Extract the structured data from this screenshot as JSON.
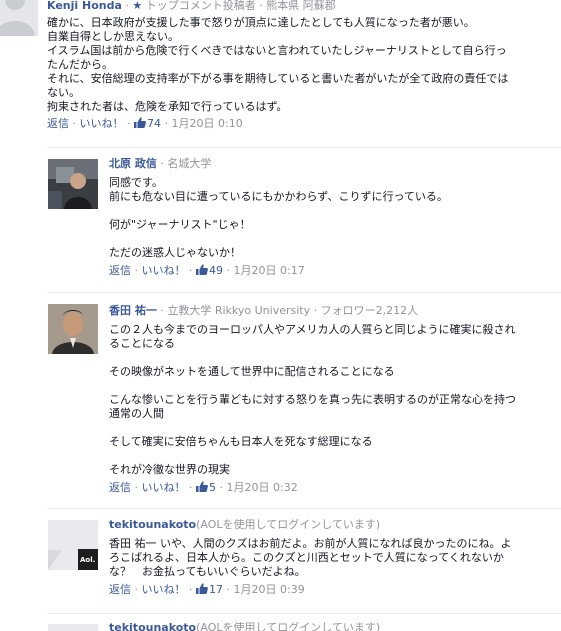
{
  "comments": [
    {
      "author": "Kenji Honda",
      "badge": "トップコメント投稿者",
      "location": "熊本県 阿蘇郡",
      "lines": [
        "確かに、日本政府が支援した事で怒りが頂点に達したとしても人質になった者が悪い。",
        "自業自得としか思えない。",
        "イスラム国は前から危険で行くべきではないと言われていたしジャーナリストとして自ら行っ",
        "たんだから。",
        "それに、安倍総理の支持率が下がる事を期待していると書いた者がいたが全て政府の責任では",
        "ない。",
        "拘束された者は、危険を承知で行っているはず。"
      ],
      "reply": "返信",
      "like": "いいね！",
      "likes": "74",
      "time": "1月20日 0:10"
    },
    {
      "author": "北原 政信",
      "school": "名城大学",
      "lines": [
        "同感です。",
        "前にも危ない目に遭っているにもかかわらず、こりずに行っている。",
        "",
        "何が\"ジャーナリスト\"じゃ！",
        "",
        "ただの迷惑人じゃないか！"
      ],
      "reply": "返信",
      "like": "いいね！",
      "likes": "49",
      "time": "1月20日 0:17"
    },
    {
      "author": "香田 祐一",
      "school": "立教大学 Rikkyo University",
      "followers": "フォロワー2,212人",
      "lines": [
        "この２人も今までのヨーロッパ人やアメリカ人の人質らと同じように確実に殺され",
        "ることになる",
        "",
        "その映像がネットを通して世界中に配信されることになる",
        "",
        "こんな惨いことを行う輩どもに対する怒りを真っ先に表明するのが正常な心を持つ",
        "通常の人間",
        "",
        "そして確実に安倍ちゃんも日本人を死なす総理になる",
        "",
        "それが冷徹な世界の現実"
      ],
      "reply": "返信",
      "like": "いいね！",
      "likes": "5",
      "time": "1月20日 0:32"
    },
    {
      "author": "tekitounakoto",
      "aol_note": "(AOLを使用してログインしています)",
      "avatar_logo": "Aol.",
      "lines": [
        "香田 祐一 いや、人間のクズはお前だよ。お前が人質になれば良かったのにね。よ",
        "ろこばれるよ、日本人から。このクズと川西とセットで人質になってくれないか",
        "な？　お金払ってもいいぐらいだよね。"
      ],
      "reply": "返信",
      "like": "いいね！",
      "likes": "17",
      "time": "1月20日 0:39"
    },
    {
      "author": "tekitounakoto",
      "aol_note": "(AOLを使用してログインしています)"
    }
  ],
  "separator": "·",
  "icons": {
    "star": "star-icon",
    "like": "thumbs-up-icon"
  },
  "colors": {
    "link": "#3b5998",
    "meta": "#90949c",
    "text": "#141823",
    "divider": "#e9ebee"
  }
}
